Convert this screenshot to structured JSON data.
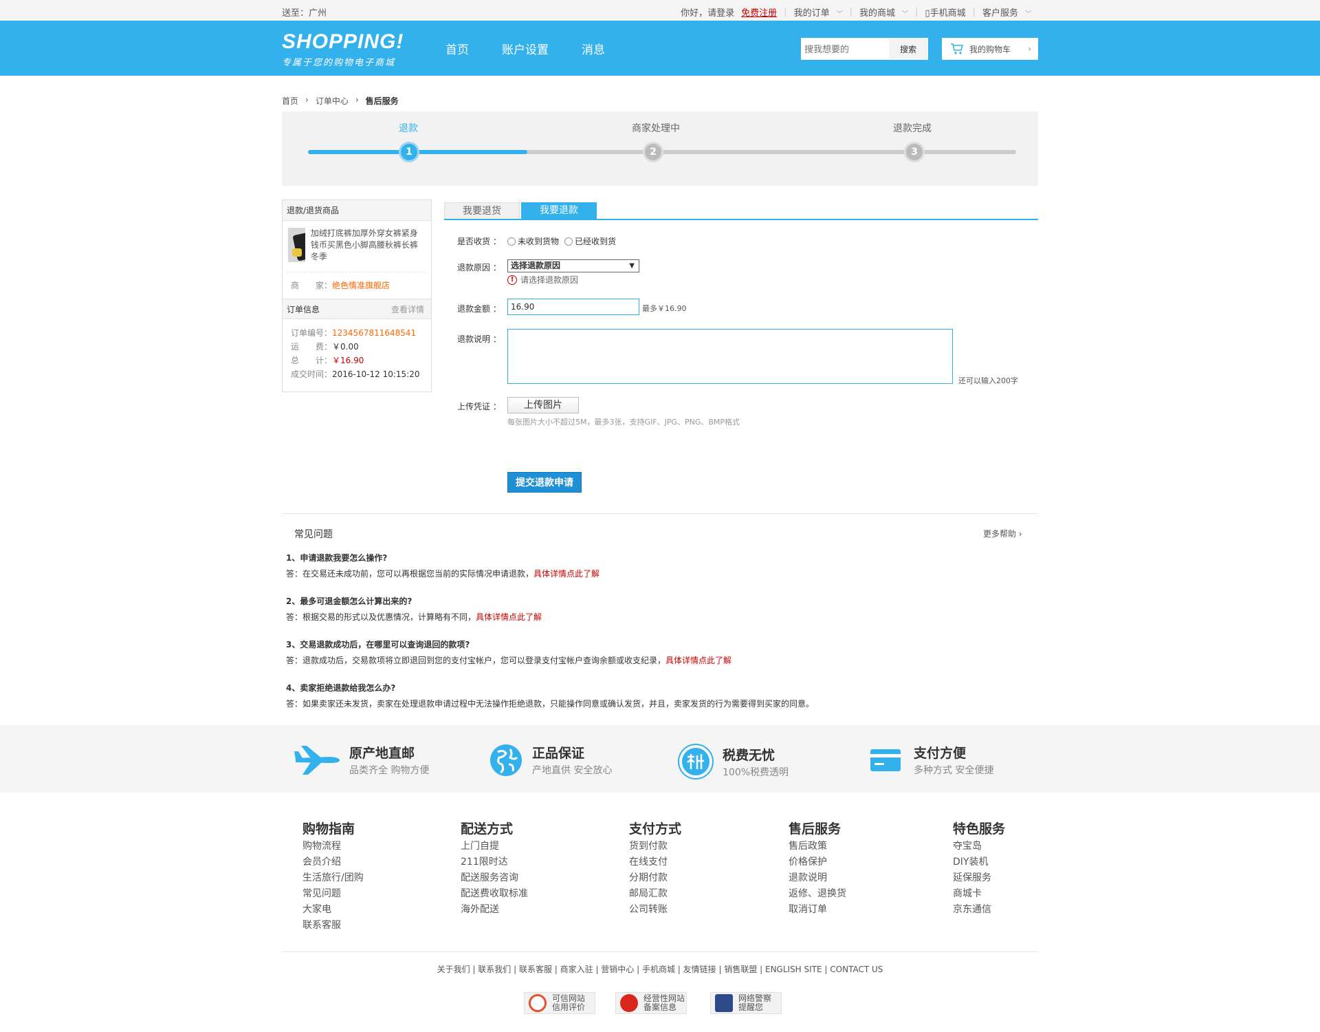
{
  "topbar": {
    "location": "送至：广州",
    "greeting": "你好，请登录",
    "register": "免费注册",
    "my_orders": "我的订单",
    "my_mall": "我的商城",
    "mobile": "手机商城",
    "service": "客户服务"
  },
  "header": {
    "logo_title": "SHOPPING!",
    "logo_slogan": "专属于您的购物电子商城",
    "nav": [
      "首页",
      "账户设置",
      "消息"
    ],
    "search_placeholder": "搜我想要的",
    "search_button": "搜索",
    "cart_label": "我的购物车"
  },
  "breadcrumb": [
    "首页",
    "订单中心",
    "售后服务"
  ],
  "progress": {
    "steps": [
      {
        "label": "退款",
        "num": "1"
      },
      {
        "label": "商家处理中",
        "num": "2"
      },
      {
        "label": "退款完成",
        "num": "3"
      }
    ],
    "fill_fraction": 0.31
  },
  "left": {
    "goods_header": "退款/退货商品",
    "product_name": "加绒打底裤加厚外穿女裤紧身钱币买黑色小脚高腰秋裤长裤冬季",
    "seller_label": "商　　家：",
    "seller": "绝色情准旗舰店",
    "order_header": "订单信息",
    "order_detail": "查看详情",
    "order_no_label": "订单编号：",
    "order_no": "1234567811648541",
    "freight_label": "运　　费：",
    "freight": "￥0.00",
    "total_label": "总　　计：",
    "total": "￥16.90",
    "time_label": "成交时间：",
    "time": "2016-10-12 10:15:20"
  },
  "form": {
    "tabs": [
      "我要退货",
      "我要退款"
    ],
    "received_label": "是否收货 ：",
    "opt_not_received": "未收到货物",
    "opt_received": "已经收到货",
    "reason_label": "退款原因 ：",
    "reason_select": "选择退款原因",
    "reason_error": "请选择退款原因",
    "amount_label": "退款金额 ：",
    "amount": "16.90",
    "amount_max": "最多￥16.90",
    "desc_label": "退款说明 ：",
    "desc_remaining": "还可以输入200字",
    "upload_label": "上传凭证 ：",
    "upload_button": "上传图片",
    "upload_hint": "每张图片大小不超过5M，最多3张，支持GIF、JPG、PNG、BMP格式",
    "submit": "提交退款申请"
  },
  "faq": {
    "title": "常见问题",
    "more": "更多帮助",
    "items": [
      {
        "q": "1、申请退款我要怎么操作?",
        "a": "答：在交易还未成功前，您可以再根据您当前的实际情况申请退款，",
        "link": "具体详情点此了解"
      },
      {
        "q": "2、最多可退金额怎么计算出来的?",
        "a": "答：根据交易的形式以及优惠情况，计算略有不同，",
        "link": "具体详情点此了解"
      },
      {
        "q": "3、交易退款成功后，在哪里可以查询退回的款项?",
        "a": "答：退款成功后，交易款项将立即退回到您的支付宝帐户，您可以登录支付宝帐户查询余额或收支纪录，",
        "link": "具体详情点此了解"
      },
      {
        "q": "4、卖家拒绝退款给我怎么办?",
        "a": "答：如果卖家还未发货，卖家在处理退款申请过程中无法操作拒绝退款，只能操作同意或确认发货，并且，卖家发货的行为需要得到买家的同意。",
        "link": ""
      }
    ]
  },
  "features": [
    {
      "icon": "plane-icon",
      "title": "原产地直邮",
      "sub": "品类齐全 购物方便"
    },
    {
      "icon": "globe-icon",
      "title": "正品保证",
      "sub": "产地直供 安全放心"
    },
    {
      "icon": "tax-icon",
      "title": "税费无忧",
      "sub": "100%税费透明"
    },
    {
      "icon": "card-icon",
      "title": "支付方便",
      "sub": "多种方式 安全便捷"
    }
  ],
  "footer": {
    "cols": [
      {
        "title": "购物指南",
        "items": [
          "购物流程",
          "会员介绍",
          "生活旅行/团购",
          "常见问题",
          "大家电",
          "联系客服"
        ]
      },
      {
        "title": "配送方式",
        "items": [
          "上门自提",
          "211限时达",
          "配送服务咨询",
          "配送费收取标准",
          "海外配送"
        ]
      },
      {
        "title": "支付方式",
        "items": [
          "货到付款",
          "在线支付",
          "分期付款",
          "邮局汇款",
          "公司转账"
        ]
      },
      {
        "title": "售后服务",
        "items": [
          "售后政策",
          "价格保护",
          "退款说明",
          "返修、退换货",
          "取消订单"
        ]
      },
      {
        "title": "特色服务",
        "items": [
          "夺宝岛",
          "DIY装机",
          "延保服务",
          "商城卡",
          "京东通信"
        ]
      }
    ],
    "links": "关于我们 | 联系我们 | 联系客服 | 商家入驻 | 营销中心 | 手机商城 | 友情链接 | 销售联盟 | ENGLISH SITE | CONTACT US",
    "badges": [
      {
        "l1": "可信网站",
        "l2": "信用评价"
      },
      {
        "l1": "经营性网站",
        "l2": "备案信息"
      },
      {
        "l1": "网络警察",
        "l2": "提醒您"
      }
    ]
  },
  "colors": {
    "brand": "#33b1ec",
    "accent": "#c00",
    "orange": "#f60"
  }
}
